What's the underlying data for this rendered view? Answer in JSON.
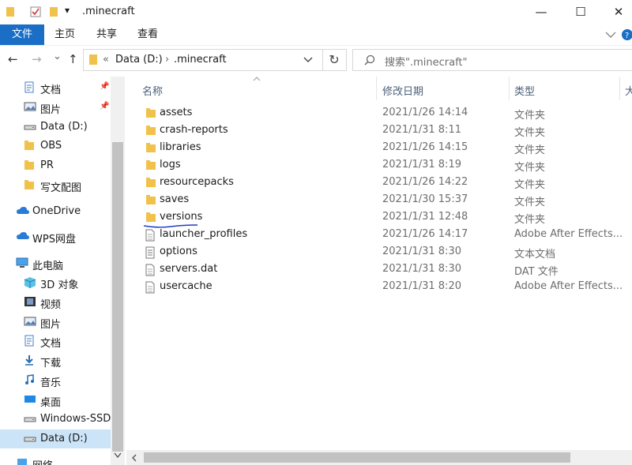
{
  "window": {
    "title": ".minecraft",
    "minimize": "—",
    "maximize": "☐",
    "close": "✕",
    "dropdown_glyph": "▾"
  },
  "ribbon": {
    "tabs": [
      "文件",
      "主页",
      "共享",
      "查看"
    ]
  },
  "navbar": {
    "back": "←",
    "forward": "→",
    "recent": "⌄",
    "up": "↑",
    "address": {
      "sep1": "«",
      "drive": "Data (D:)",
      "sep2": "›",
      "folder": ".minecraft"
    },
    "refresh": "↻",
    "search_placeholder": "搜索\".minecraft\""
  },
  "sidebar": {
    "items": [
      {
        "label": "文档",
        "icon": "document-icon",
        "pinned": true
      },
      {
        "label": "图片",
        "icon": "picture-icon",
        "pinned": true
      },
      {
        "label": "Data (D:)",
        "icon": "drive-icon"
      },
      {
        "label": "OBS",
        "icon": "folder-icon"
      },
      {
        "label": "PR",
        "icon": "folder-icon"
      },
      {
        "label": "写文配图",
        "icon": "folder-icon"
      },
      {
        "label": "OneDrive",
        "icon": "cloud-icon"
      },
      {
        "label": "WPS网盘",
        "icon": "cloud-icon"
      },
      {
        "label": "此电脑",
        "icon": "computer-icon"
      },
      {
        "label": "3D 对象",
        "icon": "cube-icon"
      },
      {
        "label": "视频",
        "icon": "video-icon"
      },
      {
        "label": "图片",
        "icon": "picture-icon"
      },
      {
        "label": "文档",
        "icon": "document-icon"
      },
      {
        "label": "下载",
        "icon": "download-icon"
      },
      {
        "label": "音乐",
        "icon": "music-icon"
      },
      {
        "label": "桌面",
        "icon": "desktop-icon"
      },
      {
        "label": "Windows-SSD (",
        "icon": "drive-icon"
      },
      {
        "label": "Data (D:)",
        "icon": "drive-icon",
        "selected": true
      },
      {
        "label": "网络",
        "icon": "network-icon"
      }
    ]
  },
  "columns": {
    "name": "名称",
    "date": "修改日期",
    "type": "类型",
    "size": "大"
  },
  "files": [
    {
      "name": "assets",
      "date": "2021/1/26 14:14",
      "type": "文件夹",
      "icon": "folder-icon"
    },
    {
      "name": "crash-reports",
      "date": "2021/1/31 8:11",
      "type": "文件夹",
      "icon": "folder-icon"
    },
    {
      "name": "libraries",
      "date": "2021/1/26 14:15",
      "type": "文件夹",
      "icon": "folder-icon"
    },
    {
      "name": "logs",
      "date": "2021/1/31 8:19",
      "type": "文件夹",
      "icon": "folder-icon"
    },
    {
      "name": "resourcepacks",
      "date": "2021/1/26 14:22",
      "type": "文件夹",
      "icon": "folder-icon"
    },
    {
      "name": "saves",
      "date": "2021/1/30 15:37",
      "type": "文件夹",
      "icon": "folder-icon"
    },
    {
      "name": "versions",
      "date": "2021/1/31 12:48",
      "type": "文件夹",
      "icon": "folder-icon"
    },
    {
      "name": "launcher_profiles",
      "date": "2021/1/26 14:17",
      "type": "Adobe After Effects...",
      "icon": "file-icon"
    },
    {
      "name": "options",
      "date": "2021/1/31 8:30",
      "type": "文本文档",
      "icon": "text-file-icon"
    },
    {
      "name": "servers.dat",
      "date": "2021/1/31 8:30",
      "type": "DAT 文件",
      "icon": "file-icon"
    },
    {
      "name": "usercache",
      "date": "2021/1/31 8:20",
      "type": "Adobe After Effects...",
      "icon": "file-icon"
    }
  ],
  "colors": {
    "accent": "#1a6ec6",
    "folder": "#f0c24b",
    "selected": "#cce4f7",
    "annotation": "#1f3fbf"
  }
}
